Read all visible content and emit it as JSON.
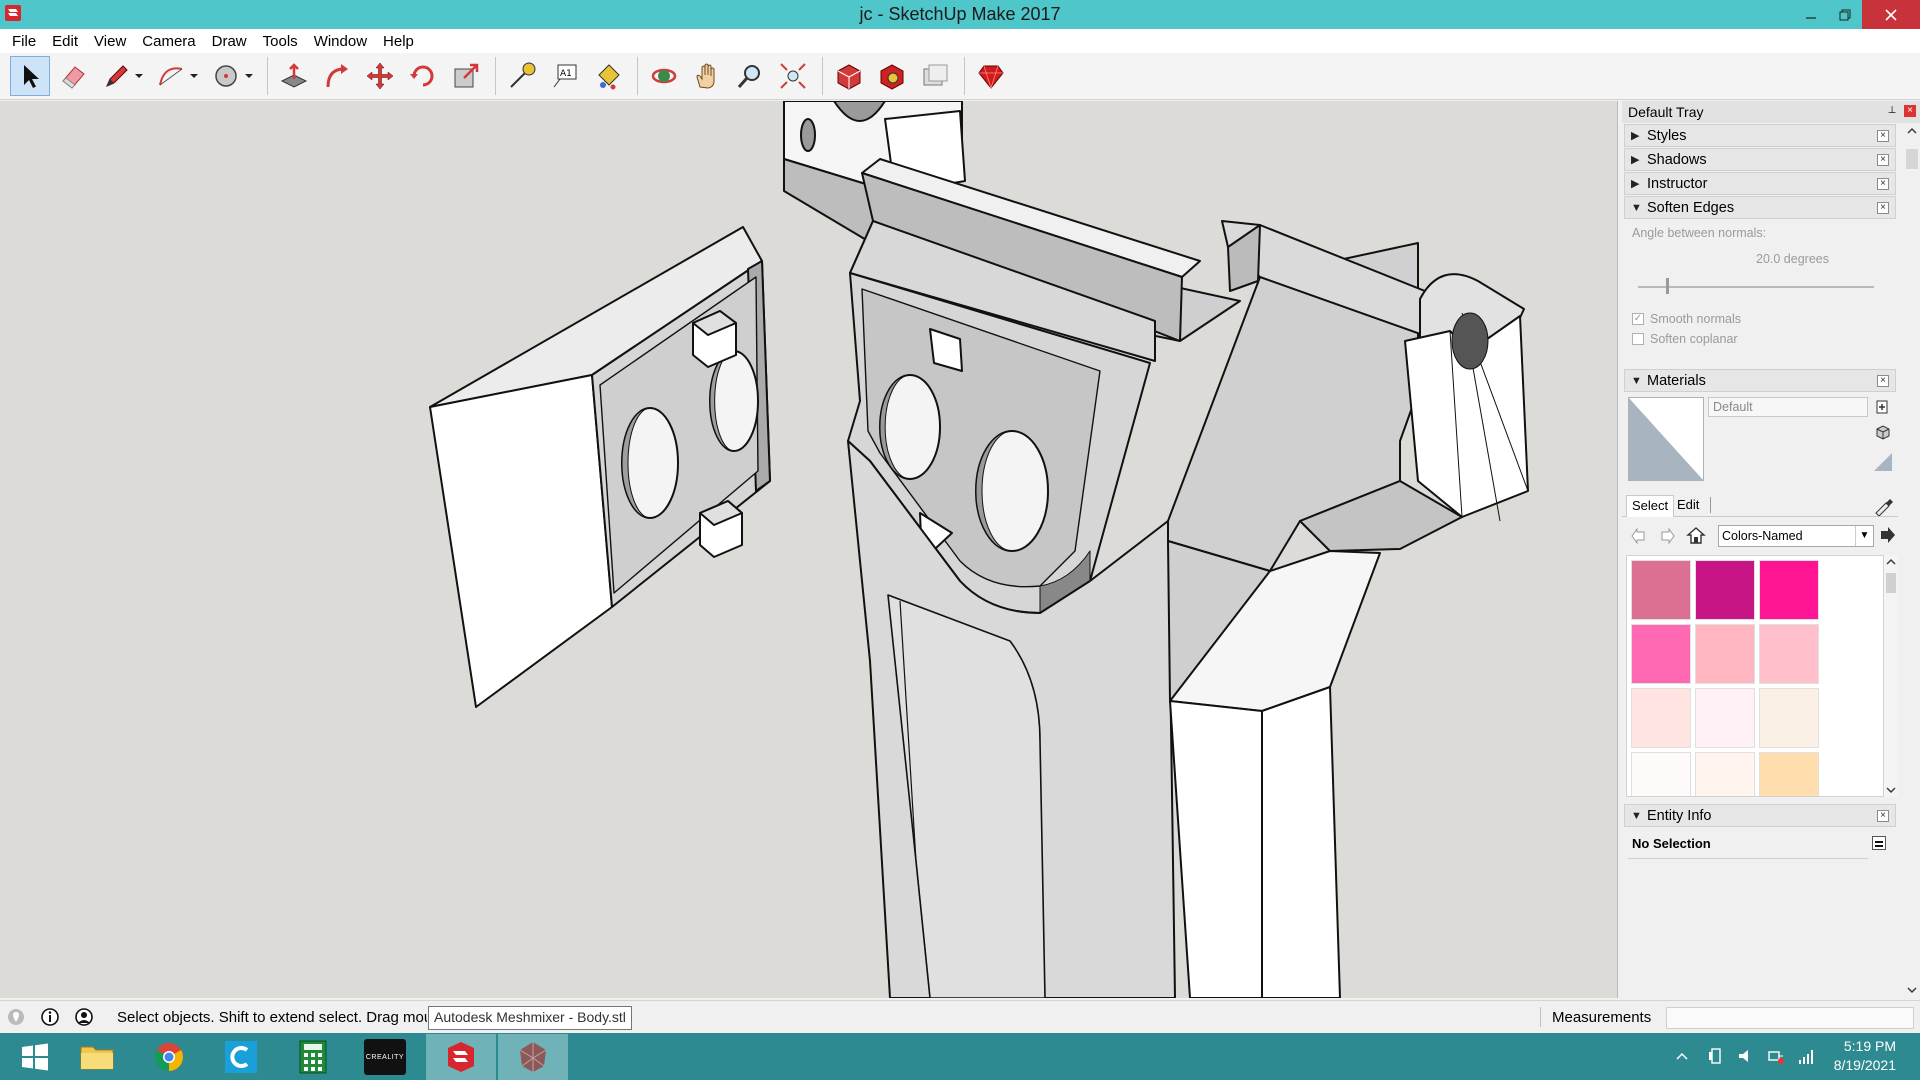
{
  "window": {
    "title": "jc - SketchUp Make 2017"
  },
  "menu": [
    "File",
    "Edit",
    "View",
    "Camera",
    "Draw",
    "Tools",
    "Window",
    "Help"
  ],
  "toolbar": {
    "tools": [
      "select-icon",
      "eraser-icon",
      "pencil-icon",
      "arc-icon",
      "shape-icon",
      "push-pull-icon",
      "offset-icon",
      "move-icon",
      "rotate-icon",
      "scale-icon",
      "tape-measure-icon",
      "text-icon",
      "paint-bucket-icon",
      "orbit-icon",
      "pan-icon",
      "zoom-icon",
      "zoom-extents-icon",
      "warehouse-icon",
      "extension-warehouse-icon",
      "layout-icon",
      "ruby-icon"
    ]
  },
  "tray": {
    "title": "Default Tray",
    "panels": {
      "styles": "Styles",
      "shadows": "Shadows",
      "instructor": "Instructor",
      "soften_edges": "Soften Edges",
      "materials": "Materials",
      "entity_info": "Entity Info"
    },
    "soften": {
      "angle_label": "Angle between normals:",
      "angle_value": "20.0  degrees",
      "angle_fraction": 0.12,
      "smooth_normals": "Smooth normals",
      "smooth_normals_checked": true,
      "soften_coplanar": "Soften coplanar",
      "soften_coplanar_checked": false
    },
    "materials": {
      "name": "Default",
      "tab_select": "Select",
      "tab_edit": "Edit",
      "collection": "Colors-Named",
      "swatches": [
        "#db7093",
        "#c71585",
        "#ff1493",
        "#ff69b4",
        "#ffb6c1",
        "#ffc0cb",
        "#ffe4e1",
        "#fff0f5",
        "#faf0e6",
        "#fffafa",
        "#fff5ee",
        "#ffdead"
      ]
    },
    "entity_info": {
      "selection": "No Selection"
    }
  },
  "status": {
    "hint": "Select objects. Shift to extend select. Drag mouse to select multiple.",
    "tooltip": "Autodesk Meshmixer - Body.stl",
    "measurements_label": "Measurements",
    "measurements_value": ""
  },
  "taskbar": {
    "time": "5:19 PM",
    "date": "8/19/2021",
    "apps": [
      "start-icon",
      "file-explorer-icon",
      "chrome-icon",
      "c-app-icon",
      "calculator-icon",
      "creality-icon",
      "sketchup-icon",
      "meshmixer-icon"
    ],
    "creality_label": "CREALITY"
  }
}
